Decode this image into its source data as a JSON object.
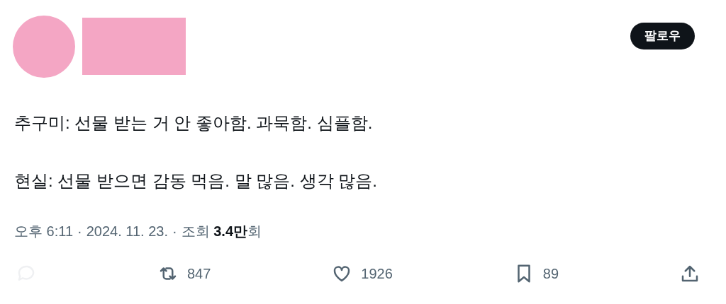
{
  "follow_button": {
    "label": "팔로우"
  },
  "paragraphs": [
    "추구미: 선물 받는 거 안 좋아함. 과묵함. 심플함.",
    "현실: 선물 받으면 감동 먹음. 말 많음. 생각 많음."
  ],
  "meta": {
    "time": "오후 6:11",
    "separator_1": "·",
    "date": "2024. 11. 23.",
    "separator_2": "·",
    "views": "조회 **3.4만**회"
  },
  "actions": [
    {
      "kind": "reply",
      "disabled": true
    },
    {
      "kind": "repost",
      "count": "847",
      "disabled": false
    },
    {
      "kind": "like",
      "count": "1926",
      "disabled": false
    },
    {
      "kind": "bookmark",
      "count": "89",
      "disabled": false
    },
    {
      "kind": "share",
      "disabled": false
    }
  ]
}
